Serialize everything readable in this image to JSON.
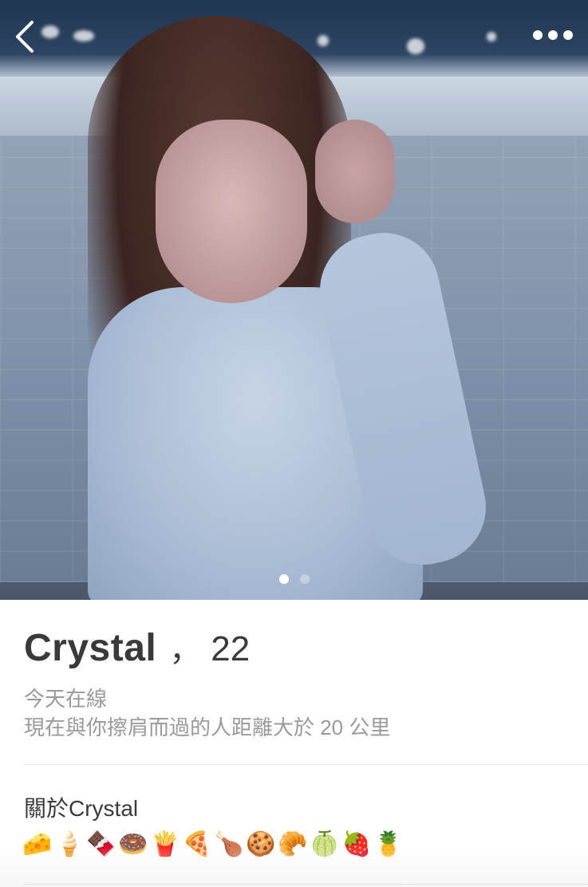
{
  "profile": {
    "name": "Crystal",
    "separator": "，",
    "age": "22",
    "status": "今天在線",
    "distance": "現在與你擦肩而過的人距離大於 20 公里"
  },
  "photo": {
    "current_index": 1,
    "count": 2
  },
  "about": {
    "title": "關於Crystal",
    "emojis": [
      "🧀",
      "🍦",
      "🍫",
      "🍩",
      "🍟",
      "🍕",
      "🍗",
      "🍪",
      "🥐",
      "🍈",
      "🍓",
      "🍍"
    ]
  },
  "icons": {
    "back": "chevron-left-icon",
    "more": "more-horizontal-icon"
  },
  "colors": {
    "text_primary": "#3a3a3a",
    "text_secondary": "#9a9a9a",
    "divider": "#e4e4e4"
  }
}
